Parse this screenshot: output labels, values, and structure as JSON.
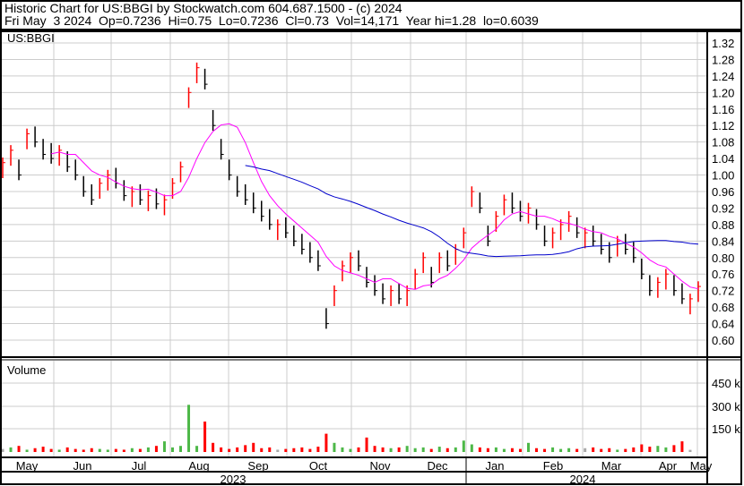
{
  "header": {
    "line1": "Historic Chart for US:BBGI by Stockwatch.com 604.687.1500 - (c) 2024",
    "line2": "Fri May  3 2024  Op=0.7236  Hi=0.75  Lo=0.7236  Cl=0.73  Vol=14,171  Year hi=1.28  lo=0.6039"
  },
  "symbol": "US:BBGI",
  "volume_label": "Volume",
  "colors": {
    "up": "#ff0000",
    "down": "#000000",
    "ma_short": "#ff00ff",
    "ma_long": "#0000cc",
    "vol_up": "#4db848",
    "vol_down": "#ff0000",
    "vol_flat": "#aaaaaa",
    "grid": "#cccccc"
  },
  "chart_data": {
    "type": "bar",
    "price_ticks": [
      "1.32",
      "1.28",
      "1.24",
      "1.20",
      "1.16",
      "1.12",
      "1.08",
      "1.04",
      "1.00",
      "0.96",
      "0.92",
      "0.88",
      "0.84",
      "0.80",
      "0.76",
      "0.72",
      "0.68",
      "0.64",
      "0.60"
    ],
    "ylim": [
      0.6,
      1.32
    ],
    "volume_ticks": [
      "450 k",
      "300 k",
      "150 k"
    ],
    "volume_ylim_k": [
      0,
      600
    ],
    "months": [
      "May",
      "Jun",
      "Jul",
      "Aug",
      "Sep",
      "Oct",
      "Nov",
      "Dec",
      "Jan",
      "Feb",
      "Mar",
      "Apr",
      "May"
    ],
    "years": [
      "2023",
      "2024"
    ],
    "bar_range": 0.05,
    "ma_short_window": 7,
    "ma_long_window": 31,
    "closes": [
      1.03,
      1.06,
      1.0,
      1.1,
      1.08,
      1.05,
      1.04,
      1.06,
      1.02,
      1.0,
      0.96,
      0.94,
      0.98,
      1.0,
      0.98,
      0.95,
      0.96,
      0.94,
      0.95,
      0.93,
      0.94,
      0.98,
      1.02,
      1.2,
      1.26,
      1.22,
      1.12,
      1.05,
      1.0,
      0.96,
      0.94,
      0.92,
      0.9,
      0.88,
      0.88,
      0.86,
      0.84,
      0.82,
      0.8,
      0.78,
      0.64,
      0.72,
      0.78,
      0.8,
      0.78,
      0.74,
      0.72,
      0.7,
      0.72,
      0.7,
      0.72,
      0.76,
      0.8,
      0.74,
      0.8,
      0.78,
      0.82,
      0.86,
      0.96,
      0.92,
      0.84,
      0.9,
      0.94,
      0.92,
      0.9,
      0.92,
      0.88,
      0.84,
      0.86,
      0.88,
      0.9,
      0.86,
      0.86,
      0.84,
      0.82,
      0.8,
      0.84,
      0.82,
      0.8,
      0.76,
      0.72,
      0.74,
      0.76,
      0.72,
      0.7,
      0.7,
      0.73
    ],
    "volumes_k": [
      20,
      30,
      40,
      15,
      25,
      35,
      20,
      15,
      30,
      20,
      15,
      25,
      20,
      15,
      20,
      15,
      25,
      20,
      30,
      40,
      70,
      30,
      40,
      310,
      40,
      200,
      60,
      30,
      20,
      30,
      45,
      60,
      25,
      30,
      15,
      20,
      25,
      30,
      20,
      35,
      120,
      60,
      30,
      20,
      30,
      95,
      40,
      30,
      25,
      30,
      40,
      25,
      30,
      20,
      35,
      25,
      30,
      75,
      50,
      30,
      25,
      30,
      20,
      25,
      20,
      60,
      25,
      20,
      30,
      20,
      25,
      20,
      25,
      30,
      20,
      25,
      15,
      20,
      30,
      50,
      35,
      40,
      30,
      45,
      70,
      14
    ]
  }
}
